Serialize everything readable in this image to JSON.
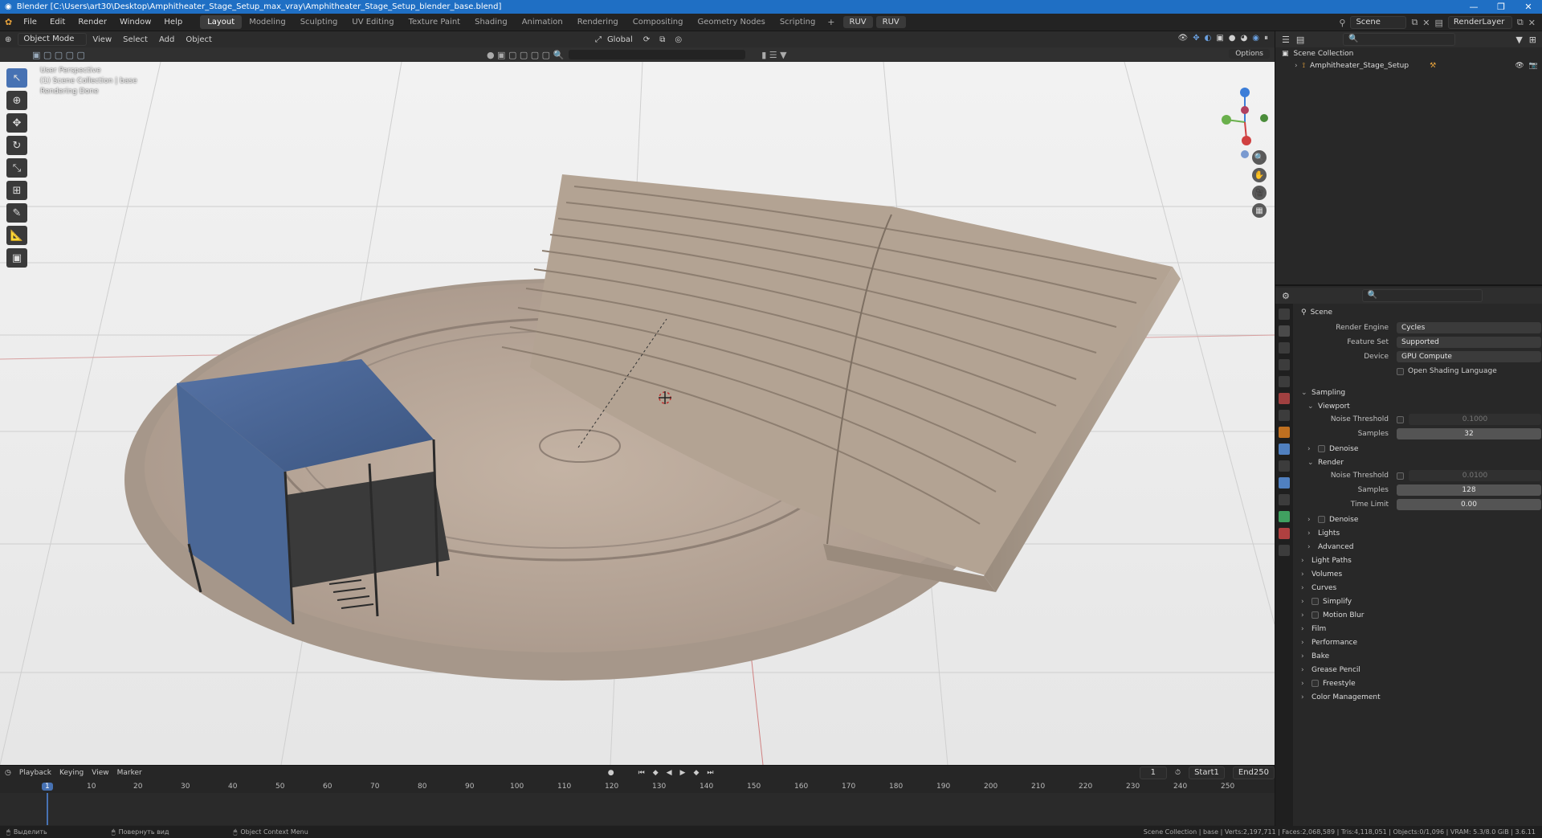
{
  "window": {
    "title": "Blender [C:\\Users\\art30\\Desktop\\Amphitheater_Stage_Setup_max_vray\\Amphitheater_Stage_Setup_blender_base.blend]",
    "controls": [
      "—",
      "❐",
      "✕"
    ]
  },
  "menu": [
    "File",
    "Edit",
    "Render",
    "Window",
    "Help"
  ],
  "workspaces": [
    {
      "label": "Layout",
      "active": true
    },
    {
      "label": "Modeling"
    },
    {
      "label": "Sculpting"
    },
    {
      "label": "UV Editing"
    },
    {
      "label": "Texture Paint"
    },
    {
      "label": "Shading"
    },
    {
      "label": "Animation"
    },
    {
      "label": "Rendering"
    },
    {
      "label": "Compositing"
    },
    {
      "label": "Geometry Nodes"
    },
    {
      "label": "Scripting"
    }
  ],
  "ruv_buttons": [
    "RUV",
    "RUV"
  ],
  "scene_field": "Scene",
  "renderlayer_field": "RenderLayer",
  "viewport": {
    "mode": "Object Mode",
    "menus": [
      "View",
      "Select",
      "Add",
      "Object"
    ],
    "transform_orientation": "Global",
    "options_label": "Options",
    "overlay_lines": [
      "User Perspective",
      "(1) Scene Collection | base",
      "Rendering Done"
    ]
  },
  "outliner": {
    "root": "Scene Collection",
    "items": [
      "Amphitheater_Stage_Setup"
    ]
  },
  "properties": {
    "header": "Scene",
    "render_engine": {
      "label": "Render Engine",
      "value": "Cycles"
    },
    "feature_set": {
      "label": "Feature Set",
      "value": "Supported"
    },
    "device": {
      "label": "Device",
      "value": "GPU Compute"
    },
    "osl": "Open Shading Language",
    "sampling": "Sampling",
    "viewport_label": "Viewport",
    "vp_noise": {
      "label": "Noise Threshold",
      "value": "0.1000"
    },
    "vp_samples": {
      "label": "Samples",
      "value": "32"
    },
    "denoise": "Denoise",
    "render_label": "Render",
    "r_noise": {
      "label": "Noise Threshold",
      "value": "0.0100"
    },
    "r_samples": {
      "label": "Samples",
      "value": "128"
    },
    "r_time": {
      "label": "Time Limit",
      "value": "0.00"
    },
    "denoise2": "Denoise",
    "lights": "Lights",
    "advanced": "Advanced",
    "sections": [
      "Light Paths",
      "Volumes",
      "Curves",
      "Simplify",
      "Motion Blur",
      "Film",
      "Performance",
      "Bake",
      "Grease Pencil",
      "Freestyle",
      "Color Management"
    ]
  },
  "timeline": {
    "menus": [
      "Playback",
      "Keying",
      "View",
      "Marker"
    ],
    "current_frame": "1",
    "start_label": "Start",
    "start": "1",
    "end_label": "End",
    "end": "250",
    "ticks": [
      "1",
      "10",
      "20",
      "30",
      "40",
      "50",
      "60",
      "70",
      "80",
      "90",
      "100",
      "110",
      "120",
      "130",
      "140",
      "150",
      "160",
      "170",
      "180",
      "190",
      "200",
      "210",
      "220",
      "230",
      "240",
      "250"
    ]
  },
  "status": {
    "left1": "Выделить",
    "left2": "Повернуть вид",
    "left3": "Object Context Menu",
    "right": "Scene Collection | base | Verts:2,197,711 | Faces:2,068,589 | Tris:4,118,051 | Objects:0/1,096 | VRAM: 5.3/8.0 GiB | 3.6.11"
  },
  "colors": {
    "accent": "#4772b3",
    "titlebar": "#1f6fc4",
    "tent": "#4a6796",
    "stone": "#b8a898"
  }
}
